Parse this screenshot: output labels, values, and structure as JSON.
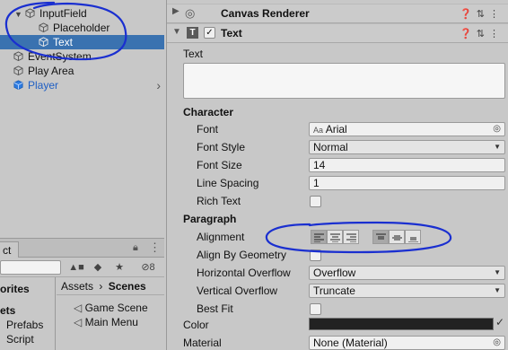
{
  "hierarchy": {
    "items": [
      {
        "label": "InputField",
        "indent": 1,
        "expanded": true
      },
      {
        "label": "Placeholder",
        "indent": 2
      },
      {
        "label": "Text",
        "indent": 2,
        "selected": true
      },
      {
        "label": "EventSystem",
        "indent": 0
      },
      {
        "label": "Play Area",
        "indent": 0
      },
      {
        "label": "Player",
        "indent": 0,
        "prefab": true
      }
    ]
  },
  "project": {
    "tab_label": "ct",
    "view_count": "8",
    "left_items": [
      "orites",
      "ets",
      "Prefabs",
      "Script"
    ],
    "breadcrumb": {
      "root": "Assets",
      "sep": "›",
      "current": "Scenes"
    },
    "files": [
      "Game Scene",
      "Main Menu"
    ]
  },
  "inspector": {
    "canvas_renderer_title": "Canvas Renderer",
    "text_component_title": "Text",
    "text_label": "Text",
    "text_value": "",
    "character_header": "Character",
    "font_label": "Font",
    "font_value": "Arial",
    "font_style_label": "Font Style",
    "font_style_value": "Normal",
    "font_size_label": "Font Size",
    "font_size_value": "14",
    "line_spacing_label": "Line Spacing",
    "line_spacing_value": "1",
    "rich_text_label": "Rich Text",
    "rich_text_checked": false,
    "paragraph_header": "Paragraph",
    "alignment_label": "Alignment",
    "horizontal_alignment": "left",
    "vertical_alignment": "top",
    "align_by_geometry_label": "Align By Geometry",
    "align_by_geometry_checked": false,
    "horizontal_overflow_label": "Horizontal Overflow",
    "horizontal_overflow_value": "Overflow",
    "vertical_overflow_label": "Vertical Overflow",
    "vertical_overflow_value": "Truncate",
    "best_fit_label": "Best Fit",
    "best_fit_checked": false,
    "color_label": "Color",
    "color_value": "#222222",
    "material_label": "Material",
    "material_value": "None (Material)"
  },
  "colors": {
    "selection": "#3a72b0",
    "annotation_ink": "#1a2fd0",
    "prefab_text": "#1f5fc4"
  }
}
